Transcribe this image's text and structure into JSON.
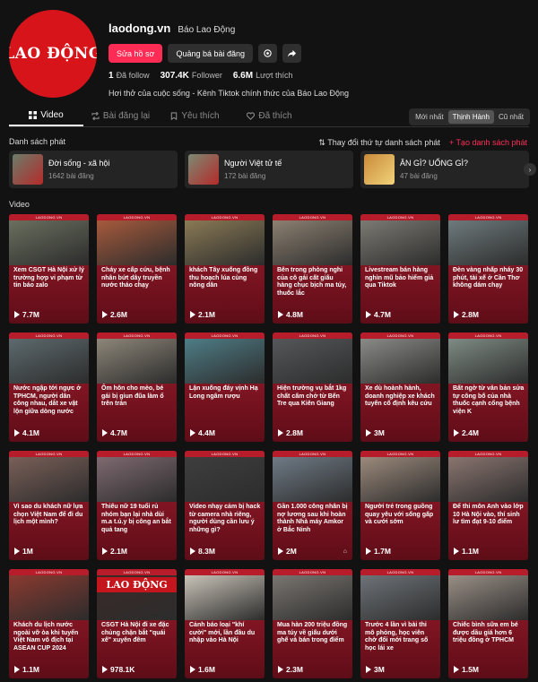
{
  "profile": {
    "logo": "LAO ĐỘNG",
    "username": "laodong.vn",
    "nickname": "Báo Lao Động",
    "edit_label": "Sửa hồ sơ",
    "promote_label": "Quảng bá bài đăng",
    "stats": [
      {
        "value": "1",
        "label": "Đã follow"
      },
      {
        "value": "307.4K",
        "label": "Follower"
      },
      {
        "value": "6.6M",
        "label": "Lượt thích"
      }
    ],
    "bio": "Hơi thở của cuộc sống - Kênh Tiktok chính thức của Báo Lao Động"
  },
  "tabs": [
    {
      "label": "Video",
      "icon": "grid-icon",
      "active": true
    },
    {
      "label": "Bài đăng lại",
      "icon": "repost-icon",
      "active": false
    },
    {
      "label": "Yêu thích",
      "icon": "bookmark-icon",
      "active": false
    },
    {
      "label": "Đã thích",
      "icon": "heart-icon",
      "active": false
    }
  ],
  "sort": [
    {
      "label": "Mới nhất",
      "active": false
    },
    {
      "label": "Thịnh Hành",
      "active": true
    },
    {
      "label": "Cũ nhất",
      "active": false
    }
  ],
  "playlists_section": {
    "title": "Danh sách phát",
    "edit_label": "Thay đổi thứ tự danh sách phát",
    "create_label": "Tạo danh sách phát",
    "items": [
      {
        "name": "Đời sống - xã hội",
        "count": "1642 bài đăng",
        "color": "#6b7d6a"
      },
      {
        "name": "Người Việt tử tế",
        "count": "172 bài đăng",
        "color": "#7c8a73"
      },
      {
        "name": "ĂN GÌ? UỐNG GÌ?",
        "count": "47 bài đăng",
        "color": "#c98a3a"
      }
    ]
  },
  "videos_section": {
    "title": "Video",
    "brand": "LAODONG.VN",
    "items": [
      {
        "caption": "Xem CSGT Hà Nội xử lý trường hợp vi phạm từ tin báo zalo",
        "views": "7.7M",
        "color": "#6a6f5e",
        "pinned": false
      },
      {
        "caption": "Cháy xe cấp cứu, bệnh nhân bứt dây truyền nước tháo chạy",
        "views": "2.6M",
        "color": "#a65a3c",
        "pinned": false
      },
      {
        "caption": "khách Tây xuống đồng thu hoạch lúa cùng nông dân",
        "views": "2.1M",
        "color": "#8a7a55",
        "pinned": false
      },
      {
        "caption": "Bên trong phòng nghi của cô gái cất giấu hàng chục bịch ma túy, thuốc lắc",
        "views": "4.8M",
        "color": "#8c8071",
        "pinned": false
      },
      {
        "caption": "Livestream bán hàng nghìn mũ bảo hiểm giả qua Tiktok",
        "views": "4.7M",
        "color": "#7b7a73",
        "pinned": false
      },
      {
        "caption": "Đèn vàng nhấp nháy 30 phút, tài xế ở Cần Thơ không dám chạy",
        "views": "2.8M",
        "color": "#6e7a7c",
        "pinned": false
      },
      {
        "caption": "Nước ngập tới ngực ở TPHCM, người dân công nhau, dắt xe vật lộn giữa dòng nước",
        "views": "4.1M",
        "color": "#5d6a6e",
        "pinned": false
      },
      {
        "caption": "Ôm hôn cho mèo, bé gái bị giun đũa làm ổ trên trán",
        "views": "4.7M",
        "color": "#8d8679",
        "pinned": false
      },
      {
        "caption": "Lặn xuống đáy vịnh Hạ Long ngâm rượu",
        "views": "4.4M",
        "color": "#4e7d86",
        "pinned": false
      },
      {
        "caption": "Hiện trường vụ bắt 1kg chất cấm chở từ Bến Tre qua Kiên Giang",
        "views": "2.8M",
        "color": "#55575a",
        "pinned": false
      },
      {
        "caption": "Xe dù hoành hành, doanh nghiệp xe khách tuyến cố định kêu cứu",
        "views": "3M",
        "color": "#8a8b87",
        "pinned": false
      },
      {
        "caption": "Bất ngờ từ văn bản sửa tự công bố của nhà thuốc cạnh cổng bệnh viện K",
        "views": "2.4M",
        "color": "#7e8b84",
        "pinned": false
      },
      {
        "caption": "Vì sao du khách nữ lựa chọn Việt Nam để đi du lịch một mình?",
        "views": "1M",
        "color": "#7a5f58",
        "pinned": false
      },
      {
        "caption": "Thiếu nữ 19 tuổi rủ nhóm bạn lại nhà dùi m.a t.ú.y bị công an bắt quả tang",
        "views": "2.1M",
        "color": "#7e6a70",
        "pinned": false
      },
      {
        "caption": "Video nhạy cảm bị hack từ camera nhà riêng, người dùng cần lưu ý những gì?",
        "views": "8.3M",
        "color": "#3e3e3e",
        "pinned": false
      },
      {
        "caption": "Gần 1.000 công nhân bị nợ lương sau khi hoàn thành Nhà máy Amkor ở Bắc Ninh",
        "views": "2M",
        "color": "#6f7b86",
        "pinned": true
      },
      {
        "caption": "Người trẻ trong guồng quay yêu với sống gấp và cưới sớm",
        "views": "1.7M",
        "color": "#9c8a7c",
        "pinned": false
      },
      {
        "caption": "Để thi môn Anh vào lớp 10 Hà Nội vào, thí sinh lư tìm đạt 9-10 điểm",
        "views": "1.1M",
        "color": "#8a7570",
        "pinned": false
      },
      {
        "caption": "Khách du lịch nước ngoài vỡ òa khi tuyển Việt Nam vô địch tại ASEAN CUP 2024",
        "views": "1.1M",
        "color": "#8a3a30",
        "pinned": false
      },
      {
        "caption": "CSGT Hà Nội đi xe đặc chủng chặn bắt \"quái xế\" xuyên đêm",
        "views": "978.1K",
        "color": "#3a2a28",
        "pinned": false,
        "logo": "LAO ĐỘNG"
      },
      {
        "caption": "Cảnh báo loại \"khí cười\" mới, lần đầu du nhập vào Hà Nội",
        "views": "1.6M",
        "color": "#c9c3b8",
        "pinned": false
      },
      {
        "caption": "Mua hàn 200 triệu đồng ma túy về giấu dưới ghế và bán trong điểm",
        "views": "2.3M",
        "color": "#7a7570",
        "pinned": false
      },
      {
        "caption": "Trước 4 lần vì bài thi mô phỏng, học viên chờ đổi mới trang số học lái xe",
        "views": "3M",
        "color": "#6e7378",
        "pinned": false
      },
      {
        "caption": "Chiếc bình sữa em bé được dầu giá hơn 6 triệu đồng ở TPHCM",
        "views": "1.5M",
        "color": "#9a8f86",
        "pinned": false
      }
    ]
  }
}
